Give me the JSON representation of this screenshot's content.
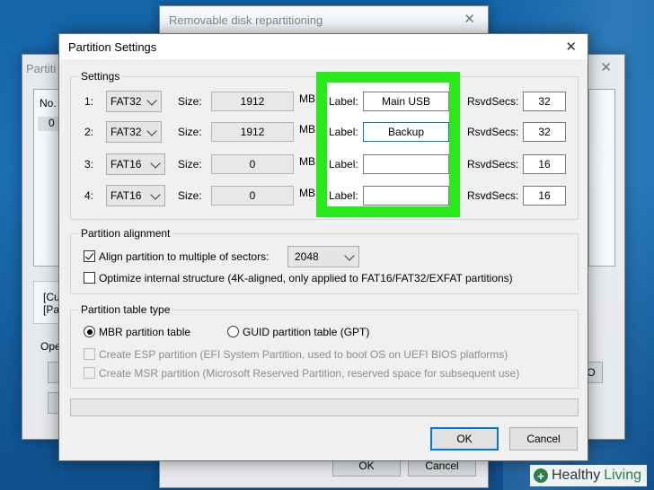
{
  "back_windows": {
    "repartition_title": "Removable disk repartitioning",
    "partition_title_partial": "Partiti",
    "col_no": "No.",
    "row_no": "0",
    "info_line1": "[Cu",
    "info_line2": "[Pa",
    "ops_partial": "Ope",
    "btn_partial": "O",
    "ok_label": "OK",
    "cancel_label": "Cancel"
  },
  "dialog": {
    "title": "Partition Settings",
    "settings_group": "Settings",
    "size_label": "Size:",
    "size_unit": "MB",
    "label_label": "Label:",
    "rsvd_label": "RsvdSecs:",
    "partitions": [
      {
        "num": "1:",
        "fs": "FAT32",
        "size": "1912",
        "label": "Main USB",
        "rsvd": "32"
      },
      {
        "num": "2:",
        "fs": "FAT32",
        "size": "1912",
        "label": "Backup",
        "rsvd": "32"
      },
      {
        "num": "3:",
        "fs": "FAT16",
        "size": "0",
        "label": "",
        "rsvd": "16"
      },
      {
        "num": "4:",
        "fs": "FAT16",
        "size": "0",
        "label": "",
        "rsvd": "16"
      }
    ],
    "alignment_group": "Partition alignment",
    "align_label": "Align partition to multiple of sectors:",
    "align_value": "2048",
    "optimize_label": "Optimize internal structure (4K-aligned, only applied to FAT16/FAT32/EXFAT partitions)",
    "table_group": "Partition table type",
    "mbr_label": "MBR partition table",
    "gpt_label": "GUID partition table (GPT)",
    "esp_label": "Create ESP partition (EFI System Partition, used to boot OS on UEFI BIOS platforms)",
    "msr_label": "Create MSR partition (Microsoft Reserved Partition, reserved space for subsequent use)",
    "ok_label": "OK",
    "cancel_label": "Cancel",
    "close_glyph": "✕"
  },
  "watermark": {
    "healthy": "Healthy",
    "living": "Living"
  },
  "colors": {
    "highlight": "#2ae81c",
    "focus": "#0078d7",
    "desktop": "#1565a8"
  }
}
